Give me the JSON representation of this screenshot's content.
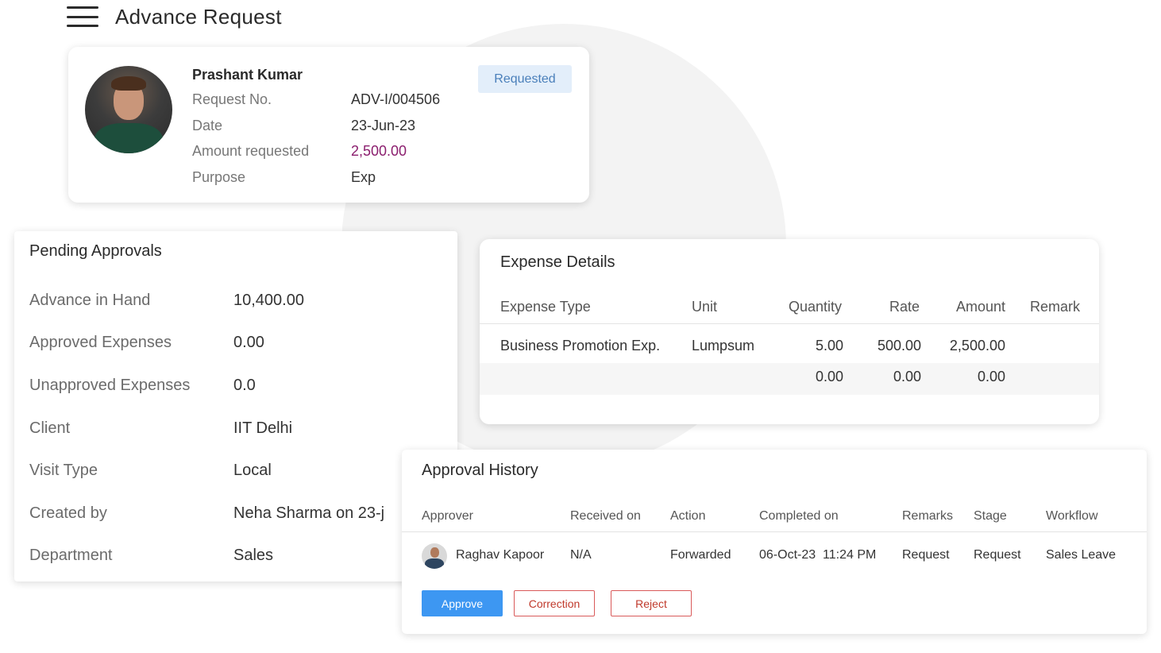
{
  "header": {
    "title": "Advance Request"
  },
  "request": {
    "name": "Prashant Kumar",
    "status": "Requested",
    "fields": [
      {
        "label": "Request No.",
        "value": "ADV-I/004506"
      },
      {
        "label": "Date",
        "value": "23-Jun-23"
      },
      {
        "label": "Amount requested",
        "value": "2,500.00"
      },
      {
        "label": "Purpose",
        "value": "Exp"
      }
    ]
  },
  "pending": {
    "title": "Pending Approvals",
    "rows": [
      {
        "label": "Advance in Hand",
        "value": "10,400.00"
      },
      {
        "label": "Approved Expenses",
        "value": "0.00"
      },
      {
        "label": "Unapproved Expenses",
        "value": "0.0"
      },
      {
        "label": "Client",
        "value": "IIT Delhi"
      },
      {
        "label": "Visit Type",
        "value": "Local"
      },
      {
        "label": "Created by",
        "value": "Neha Sharma on 23-j"
      },
      {
        "label": "Department",
        "value": "Sales"
      }
    ]
  },
  "expense": {
    "title": "Expense Details",
    "columns": [
      "Expense Type",
      "Unit",
      "Quantity",
      "Rate",
      "Amount",
      "Remark"
    ],
    "rows": [
      {
        "type": "Business Promotion Exp.",
        "unit": "Lumpsum",
        "quantity": "5.00",
        "rate": "500.00",
        "amount": "2,500.00",
        "remark": ""
      }
    ],
    "totals": {
      "quantity": "0.00",
      "rate": "0.00",
      "amount": "0.00"
    }
  },
  "history": {
    "title": "Approval History",
    "columns": [
      "Approver",
      "Received on",
      "Action",
      "Completed on",
      "Remarks",
      "Stage",
      "Workflow"
    ],
    "rows": [
      {
        "approver": "Raghav Kapoor",
        "received": "N/A",
        "action": "Forwarded",
        "completed": "06-Oct-23  11:24 PM",
        "remarks": "Request",
        "stage": "Request",
        "workflow": "Sales Leave"
      }
    ],
    "buttons": {
      "approve": "Approve",
      "correction": "Correction",
      "reject": "Reject"
    }
  },
  "colors": {
    "accent": "#3d97f2",
    "amount": "#8b1e6e",
    "badge_bg": "#e3eefa",
    "danger": "#c0392b"
  }
}
